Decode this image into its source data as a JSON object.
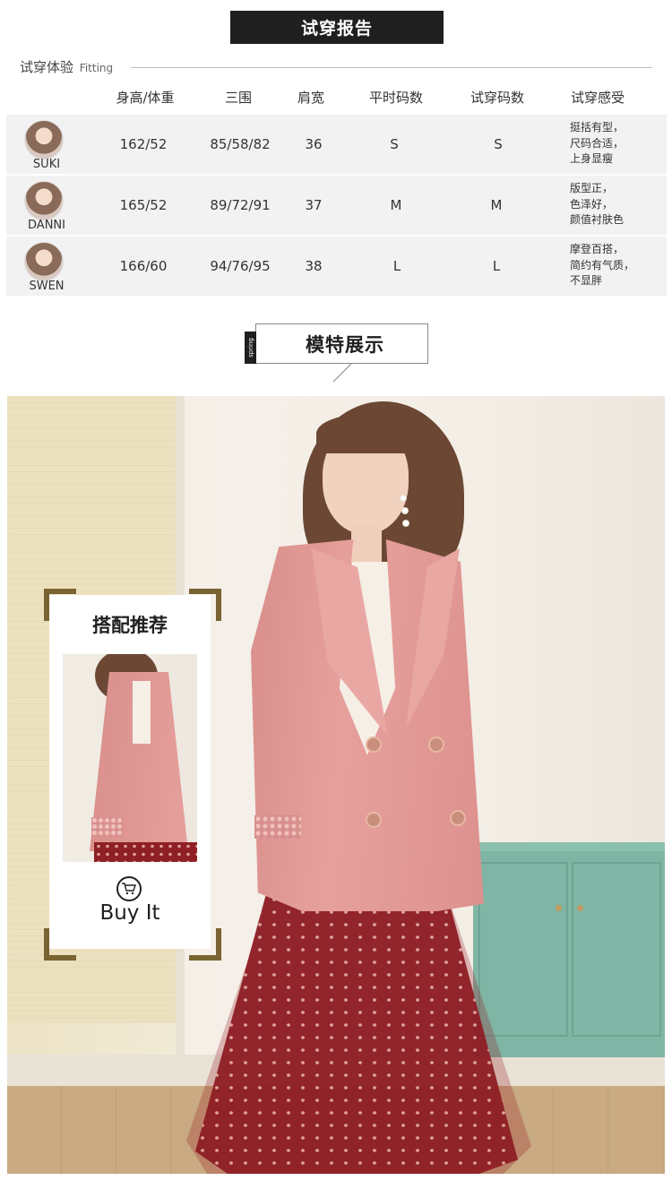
{
  "banner": {
    "title": "试穿报告"
  },
  "fitting": {
    "label_cn": "试穿体验",
    "label_en": "Fitting"
  },
  "table": {
    "headers": [
      "身高/体重",
      "三围",
      "肩宽",
      "平时码数",
      "试穿码数",
      "试穿感受"
    ],
    "rows": [
      {
        "name": "SUKI",
        "hw": "162/52",
        "measure": "85/58/82",
        "shoulder": "36",
        "usual": "S",
        "tried": "S",
        "feel": [
          "挺括有型，",
          "尺码合适，",
          "上身显瘦"
        ]
      },
      {
        "name": "DANNI",
        "hw": "165/52",
        "measure": "89/72/91",
        "shoulder": "37",
        "usual": "M",
        "tried": "M",
        "feel": [
          "版型正，",
          "色泽好，",
          "颜值衬肤色"
        ]
      },
      {
        "name": "SWEN",
        "hw": "166/60",
        "measure": "94/76/95",
        "shoulder": "38",
        "usual": "L",
        "tried": "L",
        "feel": [
          "摩登百搭，",
          "简约有气质，",
          "不显胖"
        ]
      }
    ]
  },
  "model_section": {
    "title": "模特展示",
    "tab": "spring"
  },
  "recommend": {
    "title": "搭配推荐",
    "cta": "Buy It",
    "cart_icon": "shopping-cart-icon"
  },
  "colors": {
    "banner_bg": "#1f1f1f",
    "row_bg": "#f2f2f2",
    "corner": "#7a6332",
    "jacket": "#e6a09c",
    "skirt": "#8e1f25"
  }
}
